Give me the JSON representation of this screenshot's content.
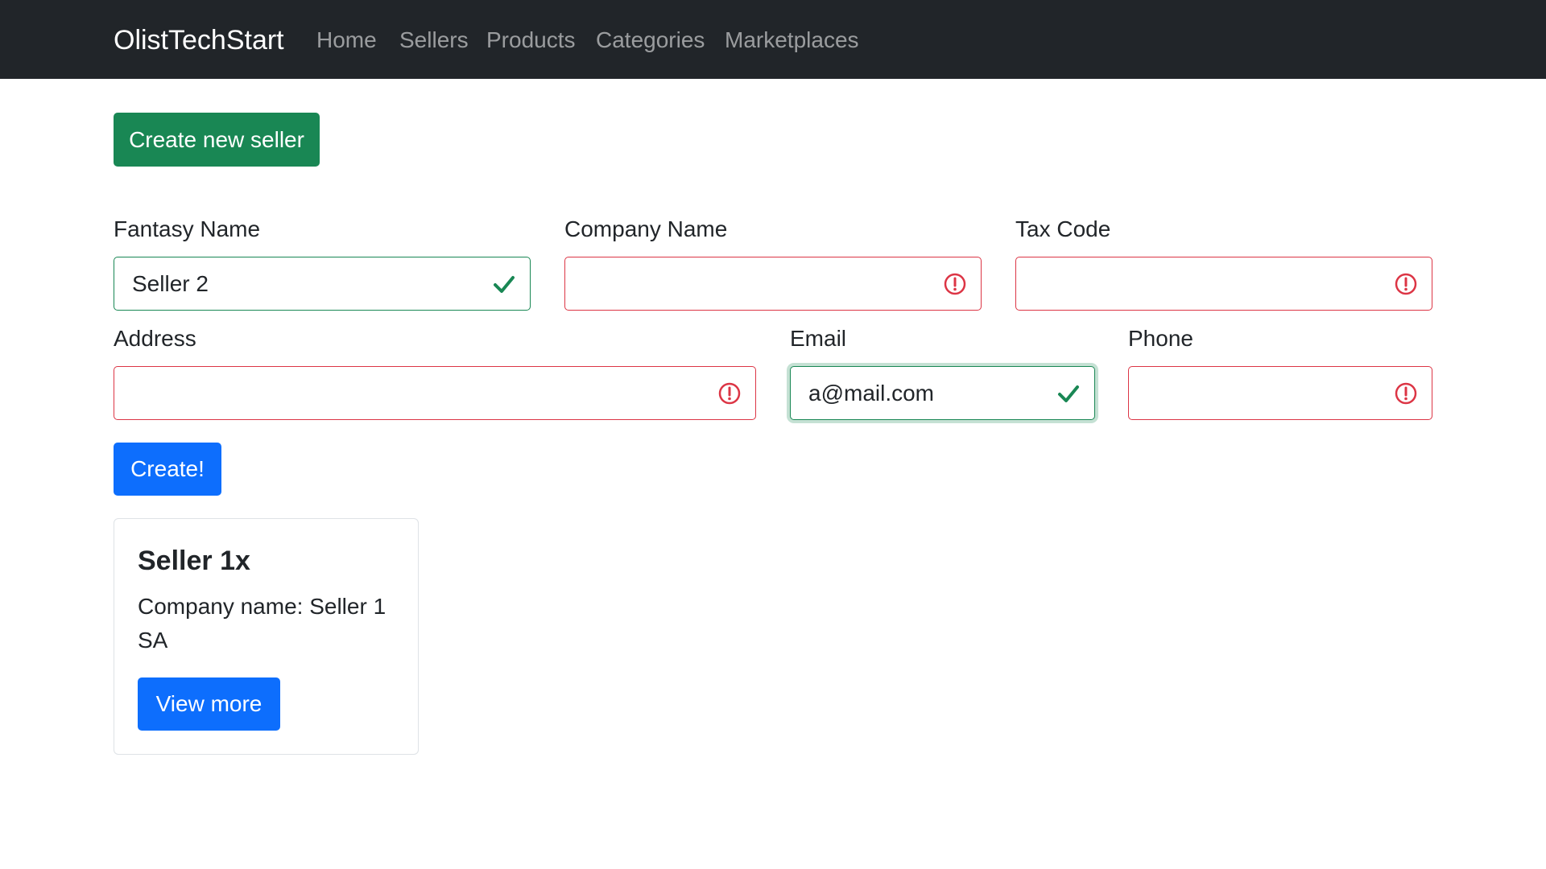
{
  "navbar": {
    "brand": "OlistTechStart",
    "links": [
      "Home",
      "Sellers",
      "Products",
      "Categories",
      "Marketplaces"
    ]
  },
  "actions": {
    "create_new_seller": "Create new seller",
    "submit": "Create!"
  },
  "form": {
    "fantasy_name": {
      "label": "Fantasy Name",
      "value": "Seller 2",
      "state": "valid"
    },
    "company_name": {
      "label": "Company Name",
      "value": "",
      "state": "invalid"
    },
    "tax_code": {
      "label": "Tax Code",
      "value": "",
      "state": "invalid"
    },
    "address": {
      "label": "Address",
      "value": "",
      "state": "invalid"
    },
    "email": {
      "label": "Email",
      "value": "a@mail.com",
      "state": "valid"
    },
    "phone": {
      "label": "Phone",
      "value": "",
      "state": "invalid"
    }
  },
  "seller_cards": [
    {
      "title": "Seller 1x",
      "text": "Company name: Seller 1 SA",
      "button": "View more"
    }
  ],
  "colors": {
    "navbar_bg": "#212529",
    "success": "#198754",
    "danger": "#dc3545",
    "primary": "#0d6efd"
  },
  "icons": {
    "valid": "check-icon",
    "invalid": "exclamation-circle-icon"
  }
}
